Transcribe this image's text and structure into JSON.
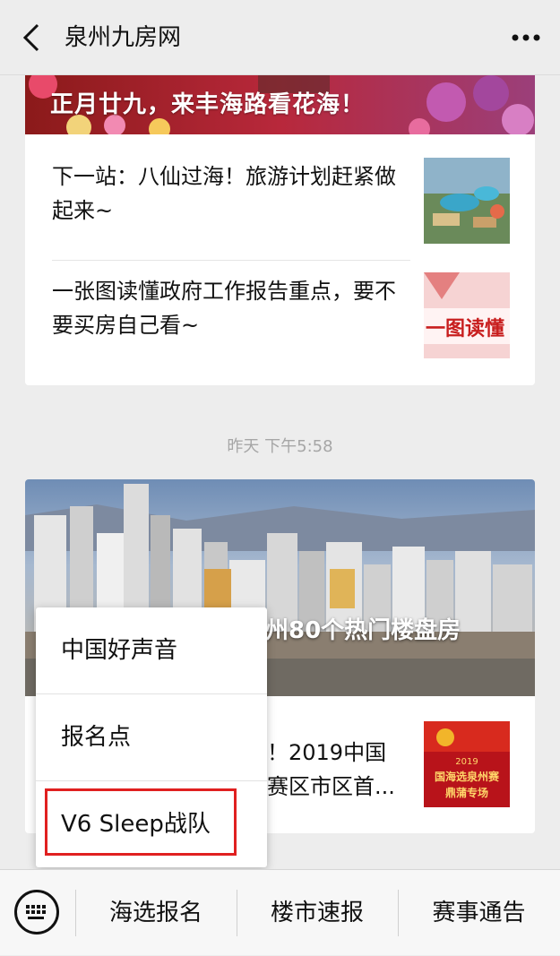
{
  "header": {
    "title": "泉州九房网"
  },
  "feed1": {
    "banner_title": "正月廿九，来丰海路看花海！",
    "articles": [
      {
        "title": "下一站：八仙过海！旅游计划赶紧做起来~"
      },
      {
        "title": "一张图读懂政府工作报告重点，要不要买房自己看~"
      }
    ]
  },
  "thumbs": {
    "report_text": "一图读懂"
  },
  "timestamp": "昨天 下午5:58",
  "feed2": {
    "hero_caption": "州80个热门楼盘房",
    "article_text": "！2019中国\n赛区市区首...",
    "thumb_text_top": "2019",
    "thumb_text_mid": "国海选泉州赛",
    "thumb_text_bottom": "鼎蒲专场"
  },
  "popup": {
    "items": [
      {
        "label": "中国好声音"
      },
      {
        "label": "报名点"
      },
      {
        "label": "V6 Sleep战队"
      }
    ]
  },
  "bottom_menu": {
    "items": [
      {
        "label": "海选报名"
      },
      {
        "label": "楼市速报"
      },
      {
        "label": "赛事通告"
      }
    ]
  }
}
